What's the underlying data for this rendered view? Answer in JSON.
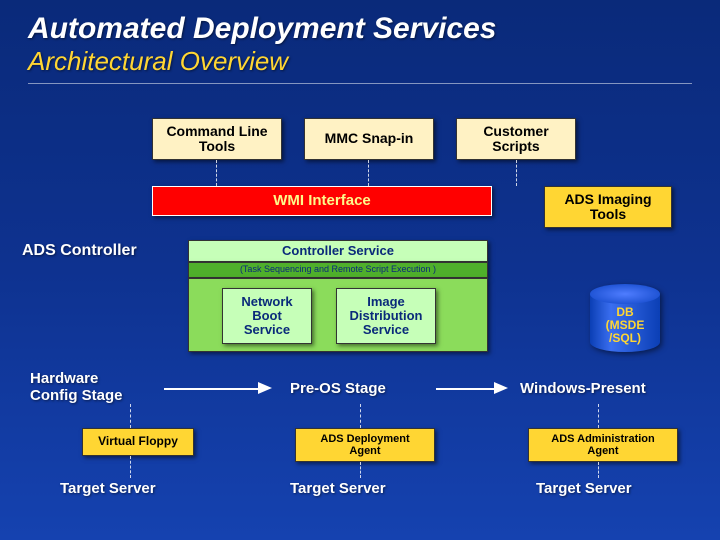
{
  "title": "Automated Deployment Services",
  "subtitle": "Architectural Overview",
  "top": {
    "cli": "Command Line\nTools",
    "mmc": "MMC Snap-in",
    "scripts": "Customer\nScripts"
  },
  "wmi": "WMI Interface",
  "imaging": "ADS Imaging\nTools",
  "controller_label": "ADS Controller",
  "controller_service": "Controller Service",
  "controller_sub": "(Task Sequencing and Remote Script Execution )",
  "services": {
    "netboot": "Network\nBoot\nService",
    "image": "Image\nDistribution\nService"
  },
  "db": "DB\n(MSDE\n/SQL)",
  "stages": {
    "hw": "Hardware\nConfig Stage",
    "preos": "Pre-OS Stage",
    "win": "Windows-Present"
  },
  "agents": {
    "floppy": "Virtual Floppy",
    "deploy": "ADS Deployment\nAgent",
    "admin": "ADS Administration\nAgent"
  },
  "target": "Target Server"
}
